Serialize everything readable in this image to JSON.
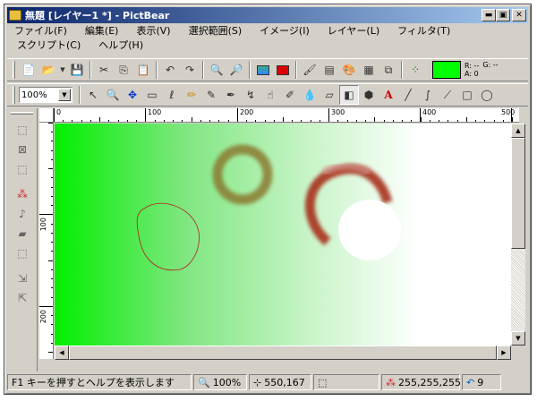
{
  "window": {
    "title": "無題 [レイヤー1 *] - PictBear",
    "min": "▬",
    "max": "▣",
    "close": "✕"
  },
  "menus": [
    "ファイル(F)",
    "編集(E)",
    "表示(V)",
    "選択範囲(S)",
    "イメージ(I)",
    "レイヤー(L)",
    "フィルタ(T)",
    "スクリプト(C)",
    "ヘルプ(H)"
  ],
  "toolbar1": {
    "icons": [
      "new-file-icon",
      "open-folder-icon",
      "dropdown-arrow-icon",
      "save-icon",
      "cut-icon",
      "copy-icon",
      "paste-icon",
      "undo-icon",
      "redo-icon",
      "zoom-in-icon",
      "zoom-out-icon",
      "image-view-icon",
      "red-image-icon",
      "brush-palette-icon",
      "layers-icon",
      "color-palette-icon",
      "properties-icon",
      "zoom-window-icon",
      "grid-icon"
    ],
    "color": "#00ff00",
    "rgb_r": "R: --",
    "rgb_a": "A: 0",
    "rgb_g": "G: --"
  },
  "toolbar2": {
    "zoom": "100%",
    "tools": [
      "pointer-icon",
      "magnifier-icon",
      "move-icon",
      "rect-select-icon",
      "lasso-icon",
      "pencil-icon",
      "brush-icon",
      "airbrush-icon",
      "smudge-icon",
      "finger-icon",
      "eraser-tool-icon",
      "dropper-icon",
      "eraser-icon",
      "gradient-icon",
      "fill-icon",
      "text-icon",
      "line-icon",
      "curve-icon",
      "spline-icon",
      "rectangle-icon",
      "ellipse-icon"
    ],
    "glyphs": [
      "↖",
      "🔍",
      "✥",
      "▭",
      "ℓ",
      "✏",
      "✎",
      "✒",
      "↯",
      "☝",
      "✐",
      "💧",
      "▱",
      "◧",
      "⬢",
      "A",
      "╱",
      "∫",
      "⟋",
      "□",
      "◯"
    ]
  },
  "ruler": {
    "top": [
      "0",
      "100",
      "200",
      "300",
      "400",
      "500"
    ],
    "left": [
      "100",
      "200"
    ]
  },
  "status": {
    "help": "F1 キーを押すとヘルプを表示します",
    "zoom": "100%",
    "coords": "550,167",
    "color": "255,255,255",
    "layers": "9"
  },
  "colors": {
    "accent": "#0a246a",
    "canvas_start": "#00f000"
  }
}
